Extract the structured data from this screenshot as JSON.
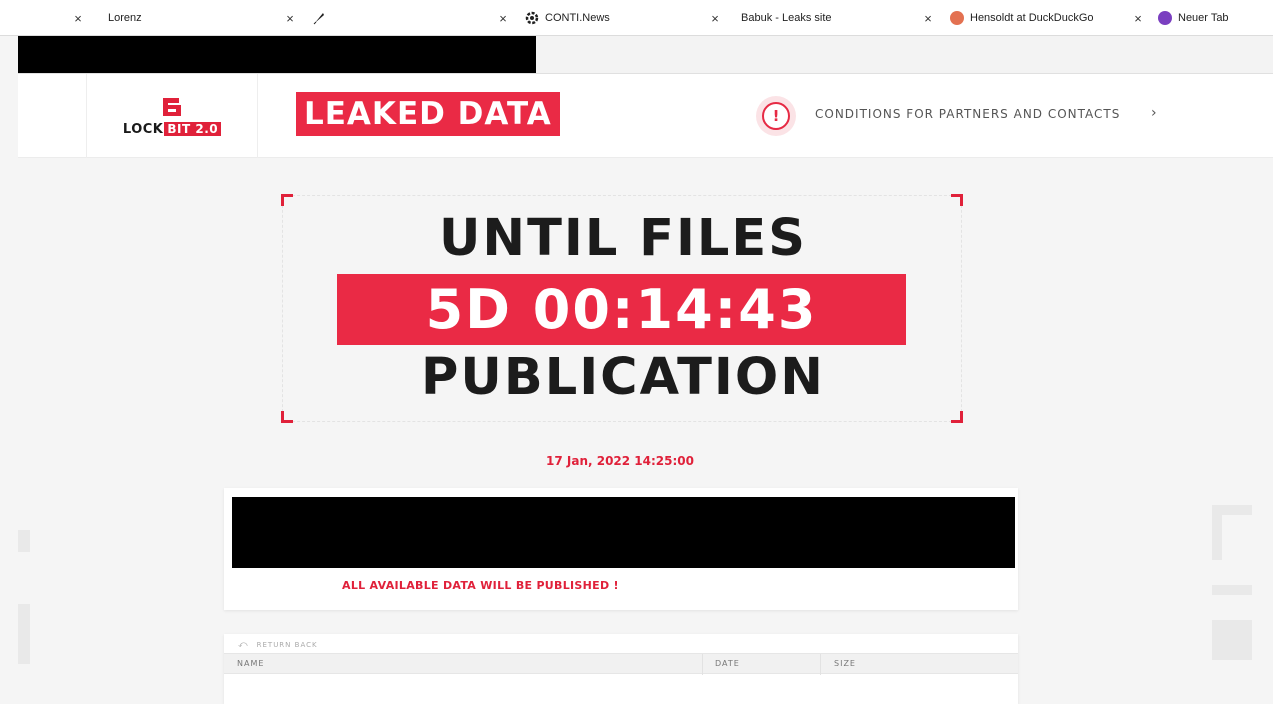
{
  "tabs": [
    {
      "label": "Lorenz",
      "icon": "generic-page-icon"
    },
    {
      "label": "",
      "icon": "quill-icon"
    },
    {
      "label": "CONTI.News",
      "icon": "gear-icon"
    },
    {
      "label": "Babuk - Leaks site",
      "icon": ""
    },
    {
      "label": "Hensoldt at DuckDuckGo",
      "icon": "duckduckgo-icon"
    },
    {
      "label": "Neuer Tab",
      "icon": "new-tab-icon"
    }
  ],
  "header": {
    "logo_text": "LOCK",
    "logo_accent": "BIT 2.0",
    "leaked_label": "LEAKED DATA",
    "alert_symbol": "!",
    "conditions_label": "CONDITIONS FOR PARTNERS AND CONTACTS",
    "conditions_chevron": "›"
  },
  "countdown": {
    "line_top": "UNTIL FILES",
    "timer": "5D 00:14:43",
    "line_bottom": "PUBLICATION",
    "publication_date": "17 Jan, 2022 14:25:00"
  },
  "notice": {
    "message": "ALL AVAILABLE DATA WILL BE PUBLISHED !"
  },
  "files": {
    "return_label": "RETURN BACK",
    "columns": {
      "name": "NAME",
      "date": "DATE",
      "size": "SIZE"
    }
  },
  "colors": {
    "accent": "#ea2a45",
    "text_dark": "#1c1c1c",
    "background": "#f5f5f5"
  }
}
